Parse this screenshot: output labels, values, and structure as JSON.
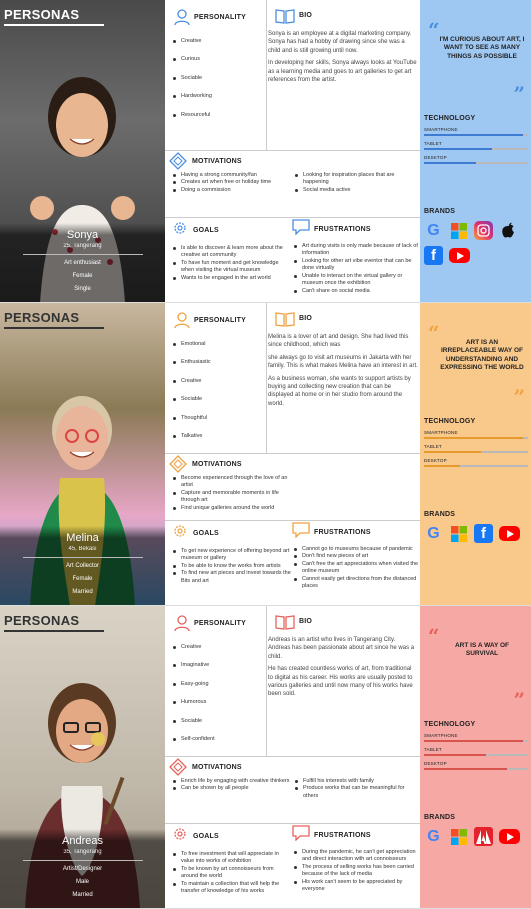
{
  "personas": [
    {
      "header": "PERSONAS",
      "name": "Sonya",
      "subtitle": "25, Tangerang",
      "meta": [
        "Art enthusiast",
        "Female",
        "Single"
      ],
      "personality_title": "PERSONALITY",
      "personality": [
        "Creative",
        "Curious",
        "Sociable",
        "Hardworking",
        "Resourceful"
      ],
      "bio_title": "BIO",
      "bio": [
        "Sonya is an employee at a digital marketing company. Sonya has had a hobby of drawing since she was a child and is still growing until now.",
        "In developing her skills, Sonya always looks at YouTube as a learning media and goes to art galleries to get art references from the artist."
      ],
      "motivations_title": "MOTIVATIONS",
      "motivations_left": [
        "Having a strong community/fan",
        "Creates art when free or holiday time",
        "Doing a commission"
      ],
      "motivations_right": [
        "Looking for inspiration places that are happening",
        "Social media active"
      ],
      "goals_title": "GOALS",
      "goals": [
        "Is able to discover & learn more about the creative art community",
        "To have fun moment and get knowledge when visiting the virtual museum",
        "Wants to be engaged in the art world"
      ],
      "frustrations_title": "FRUSTRATIONS",
      "frustrations": [
        "Art during visits is only made because of lack of information",
        "Looking for other art vibe eventor that can be done virtually",
        "Unable to interact on the virtual gallery or museum once the exhibition",
        "Can't share on social media"
      ],
      "quote": "I'M CURIOUS ABOUT ART, I WANT TO SEE AS MANY THINGS AS POSSIBLE",
      "technology_title": "TECHNOLOGY",
      "tech": [
        {
          "label": "SMARTPHONE",
          "level": 0.95
        },
        {
          "label": "TABLET",
          "level": 0.65
        },
        {
          "label": "DESKTOP",
          "level": 0.5
        }
      ],
      "brands_title": "BRANDS",
      "brands": [
        "google-icon",
        "windows-icon",
        "instagram-icon",
        "apple-icon",
        "facebook-icon",
        "youtube-icon"
      ],
      "colors": {
        "bg": "#FFFFFF",
        "panel": "#9EC8F2",
        "accent": "#4A8FE0",
        "bar": "#3E7BD2"
      }
    },
    {
      "header": "PERSONAS",
      "name": "Melina",
      "subtitle": "45, Bekasi",
      "meta": [
        "Art Collector",
        "Female",
        "Married"
      ],
      "personality_title": "PERSONALITY",
      "personality": [
        "Emotional",
        "Enthusiastic",
        "Creative",
        "Sociable",
        "Thoughtful",
        "Talkative"
      ],
      "bio_title": "BIO",
      "bio": [
        "Melina is a lover of art and design. She had lived this since childhood, which was",
        "she always go to visit art museums in Jakarta with her family. This is what makes Melina have an interest in art.",
        "As a business woman, she wants to support artists by buying and collecting new creation that can be displayed at home or in her studio from around the world."
      ],
      "motivations_title": "MOTIVATIONS",
      "motivations_left": [
        "Become experienced through the love of an artist",
        "Capture and memorable moments in life through art",
        "Find unique galleries around the world"
      ],
      "motivations_right": [],
      "goals_title": "GOALS",
      "goals": [
        "To get new experience of offering beyond art museum or gallery",
        "To be able to know the works from artists",
        "To find new art pieces and invest towards the Bits and art"
      ],
      "frustrations_title": "FRUSTRATIONS",
      "frustrations": [
        "Cannot go to museums because of pandemic",
        "Don't find new pieces of art",
        "Can't free the art appreciations when visited the online museum",
        "Cannot easily get directions from the distanced places"
      ],
      "quote": "ART IS AN IRREPLACEABLE WAY OF UNDERSTANDING AND EXPRESSING THE WORLD",
      "technology_title": "TECHNOLOGY",
      "tech": [
        {
          "label": "SMARTPHONE",
          "level": 0.95
        },
        {
          "label": "TABLET",
          "level": 0.55
        },
        {
          "label": "DESKTOP",
          "level": 0.35
        }
      ],
      "brands_title": "BRANDS",
      "brands": [
        "google-icon",
        "windows-icon",
        "facebook-icon",
        "youtube-icon"
      ],
      "colors": {
        "bg": "#FFFFFF",
        "panel": "#F9C88B",
        "accent": "#F2A141",
        "bar": "#E89A2E"
      }
    },
    {
      "header": "PERSONAS",
      "name": "Andreas",
      "subtitle": "35, Tangerang",
      "meta": [
        "Artist/Designer",
        "Male",
        "Married"
      ],
      "personality_title": "PERSONALITY",
      "personality": [
        "Creative",
        "Imaginative",
        "Easy-going",
        "Humorous",
        "Sociable",
        "Self-confident"
      ],
      "bio_title": "BIO",
      "bio": [
        "Andreas is an artist who lives in Tangerang City. Andreas has been passionate about art since he was a child.",
        "He has created countless works of art, from traditional to digital as his career. His works are usually posted to various galleries and until now many of his works have been sold."
      ],
      "motivations_title": "MOTIVATIONS",
      "motivations_left": [
        "Enrich life by engaging with creative thinkers",
        "Can be shown by all people"
      ],
      "motivations_right": [
        "Fulfill his interests with family",
        "Produce works that can be meaningful for others"
      ],
      "goals_title": "GOALS",
      "goals": [
        "To free investment that will appreciate in value into works of exhibition",
        "To be known by art connoisseurs from around the world",
        "To maintain a collection that will help the transfer of knowledge of his works"
      ],
      "frustrations_title": "FRUSTRATIONS",
      "frustrations": [
        "During the pandemic, he can't get appreciation and direct interaction with art connoisseurs",
        "The process of selling works has been carried because of the lack of media",
        "His work can't seem to be appreciated by everyone"
      ],
      "quote": "ART IS A WAY OF SURVIVAL",
      "technology_title": "TECHNOLOGY",
      "tech": [
        {
          "label": "SMARTPHONE",
          "level": 0.95
        },
        {
          "label": "TABLET",
          "level": 0.6
        },
        {
          "label": "DESKTOP",
          "level": 0.8
        }
      ],
      "brands_title": "BRANDS",
      "brands": [
        "google-icon",
        "windows-icon",
        "adobe-icon",
        "youtube-icon"
      ],
      "colors": {
        "bg": "#FFFFFF",
        "panel": "#F6A9A4",
        "accent": "#E8625C",
        "bar": "#D9534F"
      }
    }
  ]
}
